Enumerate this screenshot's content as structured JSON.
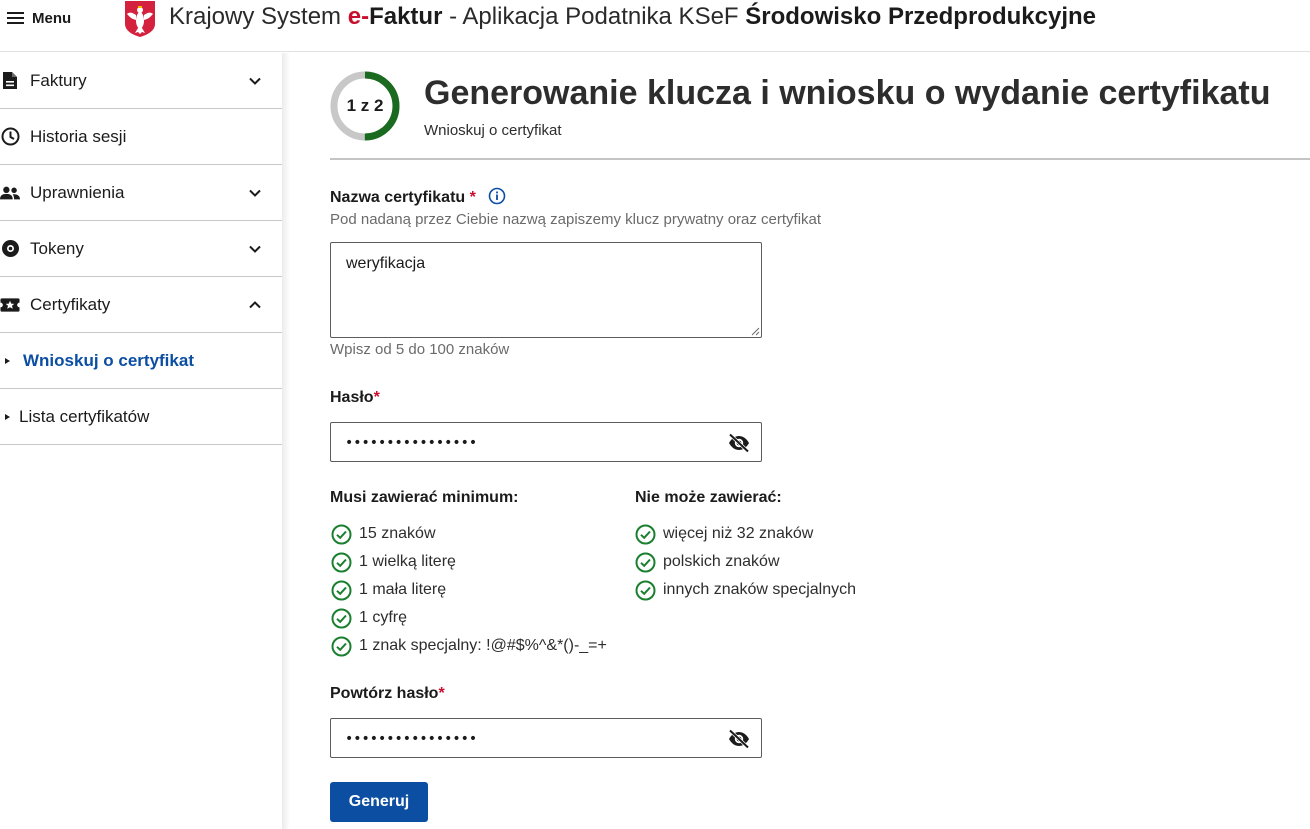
{
  "header": {
    "menu_label": "Menu",
    "title_prefix": "Krajowy System ",
    "title_brand_e": "e-",
    "title_brand_rest": "Faktur",
    "title_app": " - Aplikacja Podatnika KSeF ",
    "environment": "Środowisko Przedprodukcyjne"
  },
  "sidebar": {
    "items": [
      {
        "label": "Faktury",
        "icon": "document-icon",
        "expanded": false
      },
      {
        "label": "Historia sesji",
        "icon": "clock-icon"
      },
      {
        "label": "Uprawnienia",
        "icon": "people-icon",
        "expanded": false
      },
      {
        "label": "Tokeny",
        "icon": "token-icon",
        "expanded": false
      },
      {
        "label": "Certyfikaty",
        "icon": "certificate-icon",
        "expanded": true
      }
    ],
    "subitems": [
      {
        "label": "Wnioskuj o certyfikat",
        "active": true
      },
      {
        "label": "Lista certyfikatów",
        "active": false
      }
    ]
  },
  "main": {
    "step": {
      "label": "1 z 2",
      "current": 1,
      "total": 2
    },
    "title": "Generowanie klucza i wniosku o wydanie certyfikatu",
    "subtitle": "Wnioskuj o certyfikat",
    "cert_name": {
      "label": "Nazwa certyfikatu",
      "required_mark": "*",
      "description": "Pod nadaną przez Ciebie nazwą zapiszemy klucz prywatny oraz certyfikat",
      "value": "weryfikacja",
      "hint": "Wpisz od 5 do 100 znaków"
    },
    "password": {
      "label": "Hasło",
      "required_mark": "*",
      "value": "••••••••••••••••"
    },
    "rules": {
      "must_title": "Musi zawierać minimum:",
      "must": [
        "15 znaków",
        "1 wielką literę",
        "1 mała literę",
        "1 cyfrę",
        "1 znak specjalny: !@#$%^&*()-_=+"
      ],
      "cannot_title": "Nie może zawierać:",
      "cannot": [
        "więcej niż 32 znaków",
        "polskich znaków",
        "innych znaków specjalnych"
      ]
    },
    "repeat_password": {
      "label": "Powtórz hasło",
      "required_mark": "*",
      "value": "••••••••••••••••"
    },
    "submit_label": "Generuj"
  },
  "colors": {
    "accent": "#0b4ea2",
    "success": "#1a7f2e",
    "required": "#c8102e",
    "step_progress": "#1a6b1f"
  }
}
